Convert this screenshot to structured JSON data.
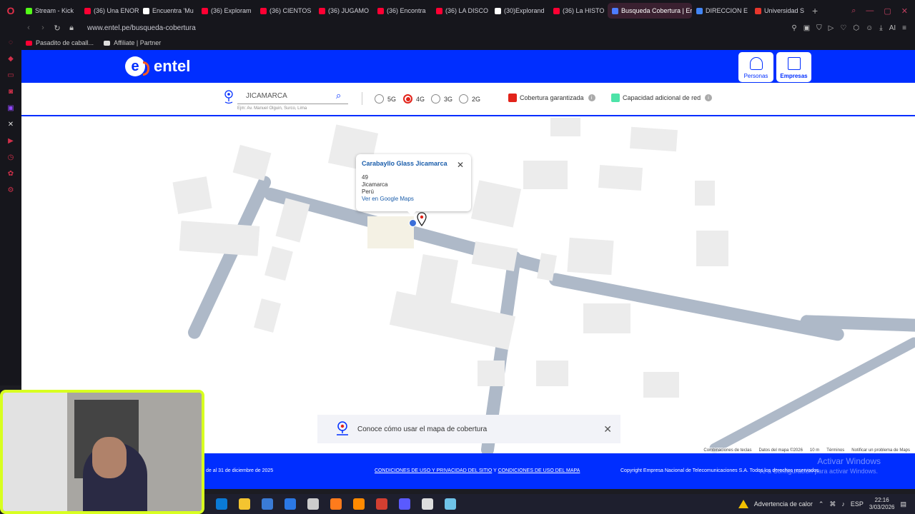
{
  "browser": {
    "tabs": [
      {
        "label": "Stream - Kick",
        "color": "#53fc18"
      },
      {
        "label": "(36) Una ENOR",
        "color": "#ff0033"
      },
      {
        "label": "Encuentra 'Mu",
        "color": "#ffffff"
      },
      {
        "label": "(36) Exploram",
        "color": "#ff0033"
      },
      {
        "label": "(36) CIENTOS",
        "color": "#ff0033"
      },
      {
        "label": "(36) JUGAMO",
        "color": "#ff0033"
      },
      {
        "label": "(36) Encontra",
        "color": "#ff0033"
      },
      {
        "label": "(36) LA DISCO",
        "color": "#ff0033"
      },
      {
        "label": "(30)Explorand",
        "color": "#ffffff"
      },
      {
        "label": "(36) La HISTO",
        "color": "#ff0033"
      },
      {
        "label": "Busqueda Cobertura | En",
        "color": "#4d7cff",
        "active": true
      },
      {
        "label": "DIRECCION E",
        "color": "#4285f4"
      },
      {
        "label": "Universidad S",
        "color": "#e8362c"
      }
    ],
    "url": "www.entel.pe/busqueda-cobertura",
    "bookmarks": [
      {
        "label": "Pasadito de caball...",
        "color": "#ff0033"
      },
      {
        "label": "Affiliate | Partner",
        "color": "#dddddd"
      }
    ]
  },
  "header": {
    "logo": "entel",
    "logo_mark": "e",
    "personas_label": "Personas",
    "empresas_label": "Empresas",
    "brand_color": "#002eff",
    "accent_color": "#ff5a1f"
  },
  "filters": {
    "search_value": "JICAMARCA",
    "search_hint": "Ejm: Av. Manuel Olguin, Surco, Lima",
    "networks": [
      {
        "label": "5G",
        "selected": false
      },
      {
        "label": "4G",
        "selected": true
      },
      {
        "label": "3G",
        "selected": false
      },
      {
        "label": "2G",
        "selected": false
      }
    ],
    "legend": [
      {
        "label": "Cobertura garantizada",
        "color": "#e2231a"
      },
      {
        "label": "Capacidad adicional de red",
        "color": "#4de3a8"
      }
    ]
  },
  "popup": {
    "title": "Carabayllo Glass Jicamarca",
    "lines": [
      "49",
      "Jicamarca",
      "Perú"
    ],
    "link": "Ver en Google Maps"
  },
  "tip": {
    "text": "Conoce cómo usar el mapa de cobertura"
  },
  "map_credits": [
    "Combinaciones de teclas",
    "Datos del mapa ©2026",
    "10 m",
    "Términos",
    "Notificar un problema de Maps"
  ],
  "footer": {
    "left_text": "de al 31 de diciembre de 2025",
    "terms_link": "CONDICIONES DE USO Y PRIVACIDAD DEL SITIO",
    "and": "Y",
    "map_terms_link": "CONDICIONES DE USO DEL MAPA",
    "copyright": "Copyright Empresa Nacional de Telecomunicaciones S.A. Todos los derechos reservados",
    "activate_title": "Activar Windows",
    "activate_sub": "Ve a Configuración para activar Windows."
  },
  "taskbar": {
    "heat_warning": "Advertencia de calor",
    "language": "ESP",
    "time": "22:16",
    "date": "3/03/2026",
    "icons": [
      "#0a7ad6",
      "#f4c430",
      "#3a7bd5",
      "#2b78e4",
      "#cccccc",
      "#ff7b1c",
      "#ff8a00",
      "#d23f31",
      "#5a5aff",
      "#dddddd",
      "#6fc3e8"
    ]
  }
}
